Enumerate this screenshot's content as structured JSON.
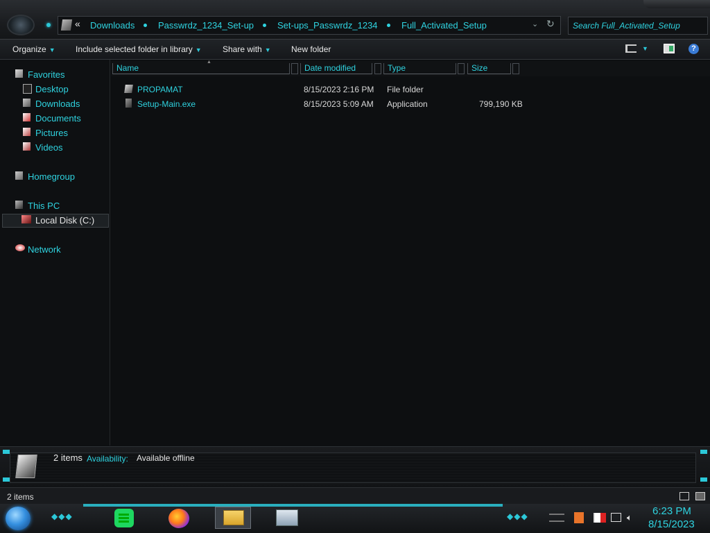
{
  "breadcrumb": {
    "items": [
      "Downloads",
      "Passwrdz_1234_Set-up",
      "Set-ups_Passwrdz_1234",
      "Full_Activated_Setup"
    ]
  },
  "search": {
    "placeholder": "Search Full_Activated_Setup"
  },
  "toolbar": {
    "organize": "Organize",
    "include_library": "Include selected folder in library",
    "share_with": "Share with",
    "new_folder": "New folder"
  },
  "sidebar": {
    "favorites": "Favorites",
    "favorites_items": [
      "Desktop",
      "Downloads",
      "Documents",
      "Pictures",
      "Videos"
    ],
    "homegroup": "Homegroup",
    "this_pc": "This PC",
    "local_disk": "Local Disk (C:)",
    "network": "Network"
  },
  "columns": {
    "name": "Name",
    "date": "Date modified",
    "type": "Type",
    "size": "Size"
  },
  "files": [
    {
      "name": "PROPAMAT",
      "date": "8/15/2023 2:16 PM",
      "type": "File folder",
      "size": ""
    },
    {
      "name": "Setup-Main.exe",
      "date": "8/15/2023 5:09 AM",
      "type": "Application",
      "size": "799,190 KB"
    }
  ],
  "details": {
    "count": "2 items",
    "availability_label": "Availability:",
    "availability_value": "Available offline"
  },
  "status": {
    "count": "2 items"
  },
  "clock": {
    "time": "6:23 PM",
    "date": "8/15/2023"
  },
  "colors": {
    "accent": "#2fd3e0",
    "background": "#0d0f11"
  },
  "icons": {
    "taskbar": [
      "start-orb-icon",
      "spotify-icon",
      "firefox-icon",
      "file-explorer-icon",
      "performance-monitor-icon"
    ],
    "tray": [
      "notification-icon",
      "flag-icon",
      "network-icon",
      "volume-icon"
    ]
  }
}
